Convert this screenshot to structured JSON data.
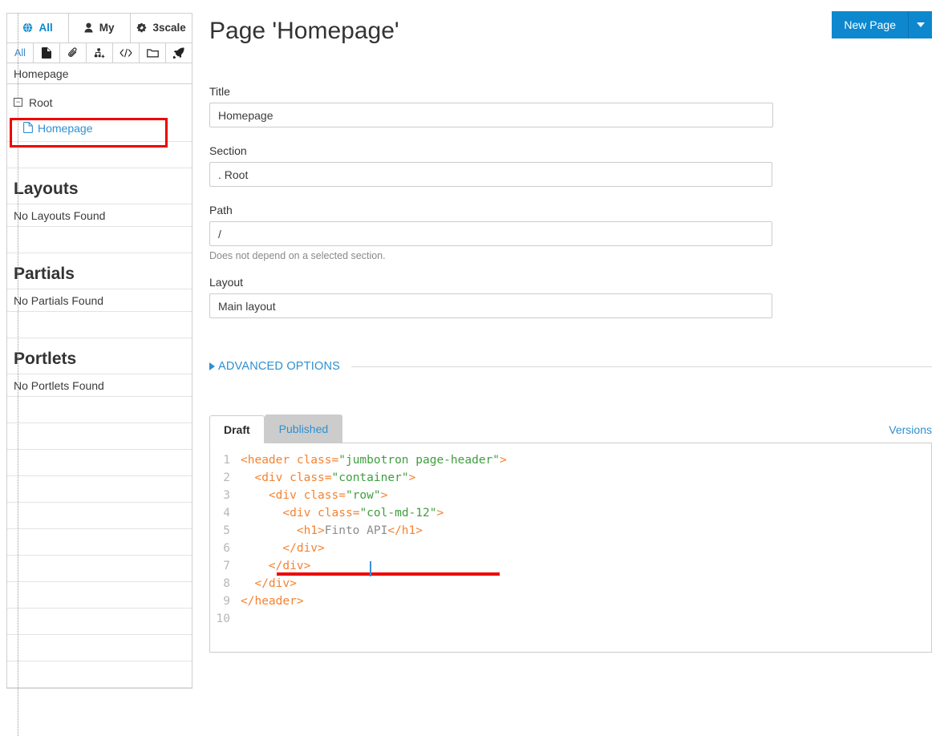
{
  "sidebar": {
    "tabs": [
      {
        "label": "All",
        "icon": "globe-icon",
        "active": true
      },
      {
        "label": "My",
        "icon": "user-icon",
        "active": false
      },
      {
        "label": "3scale",
        "icon": "gear-icon",
        "active": false
      }
    ],
    "icon_bar": [
      {
        "name": "filter-all",
        "label": "All"
      },
      {
        "name": "page-icon",
        "label": ""
      },
      {
        "name": "paperclip-icon",
        "label": ""
      },
      {
        "name": "sitemap-add-icon",
        "label": ""
      },
      {
        "name": "code-icon",
        "label": ""
      },
      {
        "name": "folder-icon",
        "label": ""
      },
      {
        "name": "rocket-icon",
        "label": ""
      }
    ],
    "filter_value": "Homepage",
    "filter_placeholder": "Homepage",
    "tree": {
      "root_label": "Root",
      "toggle_glyph": "−",
      "children": [
        {
          "label": "Homepage",
          "icon": "page-icon",
          "highlighted": true
        }
      ]
    },
    "sections": [
      {
        "title": "Layouts",
        "empty_text": "No Layouts Found"
      },
      {
        "title": "Partials",
        "empty_text": "No Partials Found"
      },
      {
        "title": "Portlets",
        "empty_text": "No Portlets Found"
      }
    ]
  },
  "header": {
    "title": "Page 'Homepage'",
    "new_page_label": "New Page",
    "dropdown_icon": "caret-down-icon"
  },
  "form": {
    "title": {
      "label": "Title",
      "value": "Homepage"
    },
    "section": {
      "label": "Section",
      "value": ". Root"
    },
    "path": {
      "label": "Path",
      "value": "/",
      "help": "Does not depend on a selected section."
    },
    "layout": {
      "label": "Layout",
      "value": "Main layout"
    },
    "advanced_options_label": "ADVANCED OPTIONS"
  },
  "editor": {
    "tabs": [
      {
        "label": "Draft",
        "active": true
      },
      {
        "label": "Published",
        "active": false
      }
    ],
    "versions_label": "Versions",
    "lines": [
      {
        "n": "1",
        "text": "<header class=\"jumbotron page-header\">"
      },
      {
        "n": "2",
        "text": "  <div class=\"container\">"
      },
      {
        "n": "3",
        "text": "    <div class=\"row\">"
      },
      {
        "n": "4",
        "text": "      <div class=\"col-md-12\">"
      },
      {
        "n": "5",
        "text": "        <h1>Finto API</h1>"
      },
      {
        "n": "6",
        "text": "      </div>"
      },
      {
        "n": "7",
        "text": "    </div>"
      },
      {
        "n": "8",
        "text": "  </div>"
      },
      {
        "n": "9",
        "text": "</header>"
      },
      {
        "n": "10",
        "text": ""
      }
    ],
    "caret_after_text": "Finto"
  },
  "colors": {
    "accent": "#0d88ce",
    "link": "#2f8fd0",
    "annotation": "#ee0000",
    "tag": "#f58231",
    "string": "#3f9e3f",
    "line_number": "#b7b7b7"
  }
}
